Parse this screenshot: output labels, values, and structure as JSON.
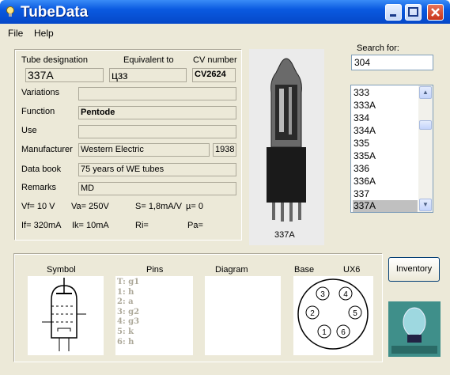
{
  "window": {
    "title": "TubeData"
  },
  "menu": {
    "file": "File",
    "help": "Help"
  },
  "form": {
    "designation_label": "Tube designation",
    "designation_value": "337A",
    "equivalent_label": "Equivalent to",
    "equivalent_value": "цзз",
    "cv_label": "CV number",
    "cv_value": "CV2624",
    "variations_label": "Variations",
    "variations_value": "",
    "function_label": "Function",
    "function_value": "Pentode",
    "use_label": "Use",
    "use_value": "",
    "manufacturer_label": "Manufacturer",
    "manufacturer_value": "Western Electric",
    "year_value": "1938",
    "databook_label": "Data book",
    "databook_value": "75 years of WE tubes",
    "remarks_label": "Remarks",
    "remarks_value": "MD",
    "vf": "Vf= 10 V",
    "va": "Va= 250V",
    "s": "S= 1,8mA/V",
    "mu": "µ=    0",
    "if": "If= 320mA",
    "ik": "Ik=  10mA",
    "ri": "Ri=",
    "pa": "Pa="
  },
  "image": {
    "caption": "337A"
  },
  "search": {
    "label": "Search for:",
    "value": "304"
  },
  "list": {
    "items": [
      "333",
      "333A",
      "334",
      "334A",
      "335",
      "335A",
      "336",
      "336A",
      "337",
      "337A"
    ],
    "selected": "337A"
  },
  "bottom": {
    "symbol_label": "Symbol",
    "pins_label": "Pins",
    "diagram_label": "Diagram",
    "base_label": "Base",
    "base_code": "UX6",
    "pins": [
      "T: g1",
      "1: h",
      "2: a",
      "3: g2",
      "4: g3",
      "5: k",
      "6: h"
    ],
    "base_pins": [
      "1",
      "2",
      "3",
      "4",
      "5",
      "6"
    ]
  },
  "inventory_button": "Inventory"
}
